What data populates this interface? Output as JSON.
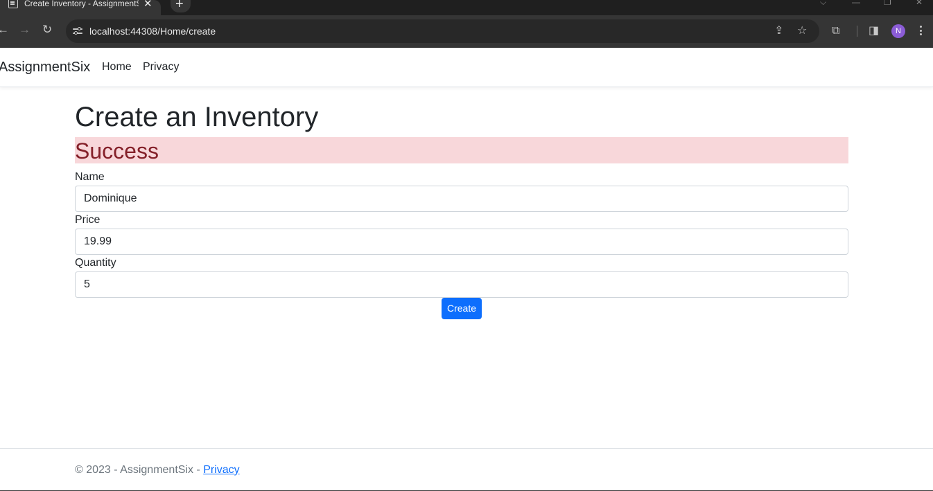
{
  "browser": {
    "tab_title": "Create Inventory - AssignmentSix",
    "new_tab_icon": "+",
    "url": "localhost:44308/Home/create",
    "avatar_initial": "N"
  },
  "navbar": {
    "brand": "AssignmentSix",
    "links": [
      "Home",
      "Privacy"
    ]
  },
  "main": {
    "title": "Create an Inventory",
    "alert": "Success",
    "fields": [
      {
        "label": "Name",
        "value": "Dominique"
      },
      {
        "label": "Price",
        "value": "19.99"
      },
      {
        "label": "Quantity",
        "value": "5"
      }
    ],
    "submit_label": "Create"
  },
  "footer": {
    "text": "© 2023 - AssignmentSix - ",
    "link": "Privacy"
  },
  "colors": {
    "primary": "#0d6efd",
    "alert_bg": "#f8d7da",
    "alert_text": "#842029",
    "browser_dark": "#353535"
  }
}
